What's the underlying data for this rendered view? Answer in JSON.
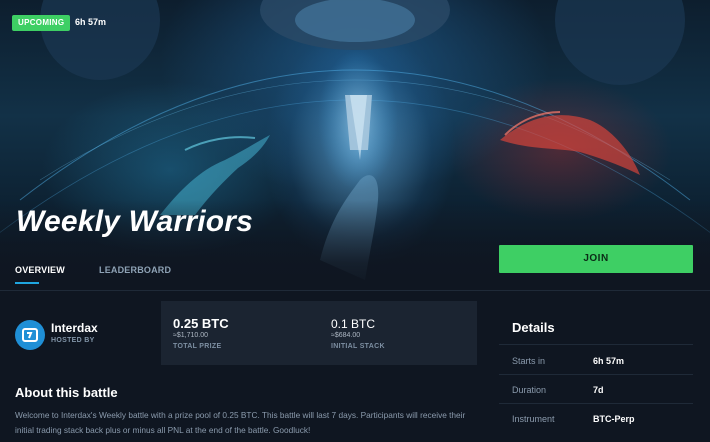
{
  "badge": "UPCOMING",
  "countdown": "6h 57m",
  "title": "Weekly Warriors",
  "tabs": [
    "OVERVIEW",
    "LEADERBOARD"
  ],
  "join_label": "JOIN",
  "host": {
    "name": "Interdax",
    "subtitle": "HOSTED BY"
  },
  "stats": {
    "prize": {
      "value": "0.25 BTC",
      "approx": "≈$1,710.00",
      "label": "TOTAL PRIZE"
    },
    "stack": {
      "value": "0.1 BTC",
      "approx": "≈$684.00",
      "label": "INITIAL STACK"
    }
  },
  "about": {
    "title": "About this battle",
    "text": "Welcome to Interdax's Weekly battle with a prize pool of 0.25 BTC. This battle will last 7 days. Participants will receive their initial trading stack back plus or minus all PNL at the end of the battle. Goodluck!"
  },
  "details": {
    "title": "Details",
    "rows": [
      {
        "label": "Starts in",
        "value": "6h 57m"
      },
      {
        "label": "Duration",
        "value": "7d"
      },
      {
        "label": "Instrument",
        "value": "BTC-Perp"
      }
    ]
  },
  "colors": {
    "accent_green": "#3ecf64",
    "accent_blue": "#1fa6e0",
    "background": "#0f1621"
  }
}
